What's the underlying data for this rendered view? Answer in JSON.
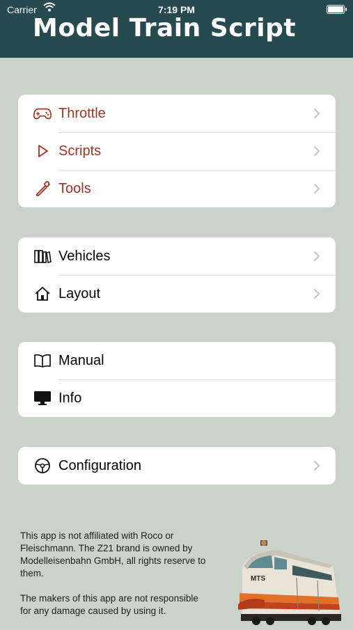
{
  "status_bar": {
    "carrier": "Carrier",
    "time": "7:19 PM"
  },
  "header": {
    "title": "Model Train Script",
    "background": "#274a50"
  },
  "colors": {
    "background": "#c9d3ca",
    "accent": "#a5321f",
    "card": "#ffffff",
    "chevron": "#c4c4c7"
  },
  "sections": [
    {
      "items": [
        {
          "label": "Throttle",
          "icon": "gamepad-icon",
          "accent": true,
          "chevron": true
        },
        {
          "label": "Scripts",
          "icon": "play-icon",
          "accent": true,
          "chevron": true
        },
        {
          "label": "Tools",
          "icon": "wrench-icon",
          "accent": true,
          "chevron": true
        }
      ]
    },
    {
      "items": [
        {
          "label": "Vehicles",
          "icon": "books-icon",
          "accent": false,
          "chevron": true
        },
        {
          "label": "Layout",
          "icon": "house-icon",
          "accent": false,
          "chevron": true
        }
      ]
    },
    {
      "items": [
        {
          "label": "Manual",
          "icon": "book-icon",
          "accent": false,
          "chevron": false
        },
        {
          "label": "Info",
          "icon": "monitor-icon",
          "accent": false,
          "chevron": false
        }
      ]
    },
    {
      "items": [
        {
          "label": "Configuration",
          "icon": "steering-wheel-icon",
          "accent": false,
          "chevron": true
        }
      ]
    }
  ],
  "disclaimer": {
    "affiliation": "This app is not affiliated with Roco or Fleischmann. The Z21 brand is owned by Modelleisenbahn GmbH, all rights reserve to them.",
    "liability": "The makers of this app are not responsible for any damage caused by using it."
  },
  "train_image": {
    "plate_text": "MTS"
  }
}
